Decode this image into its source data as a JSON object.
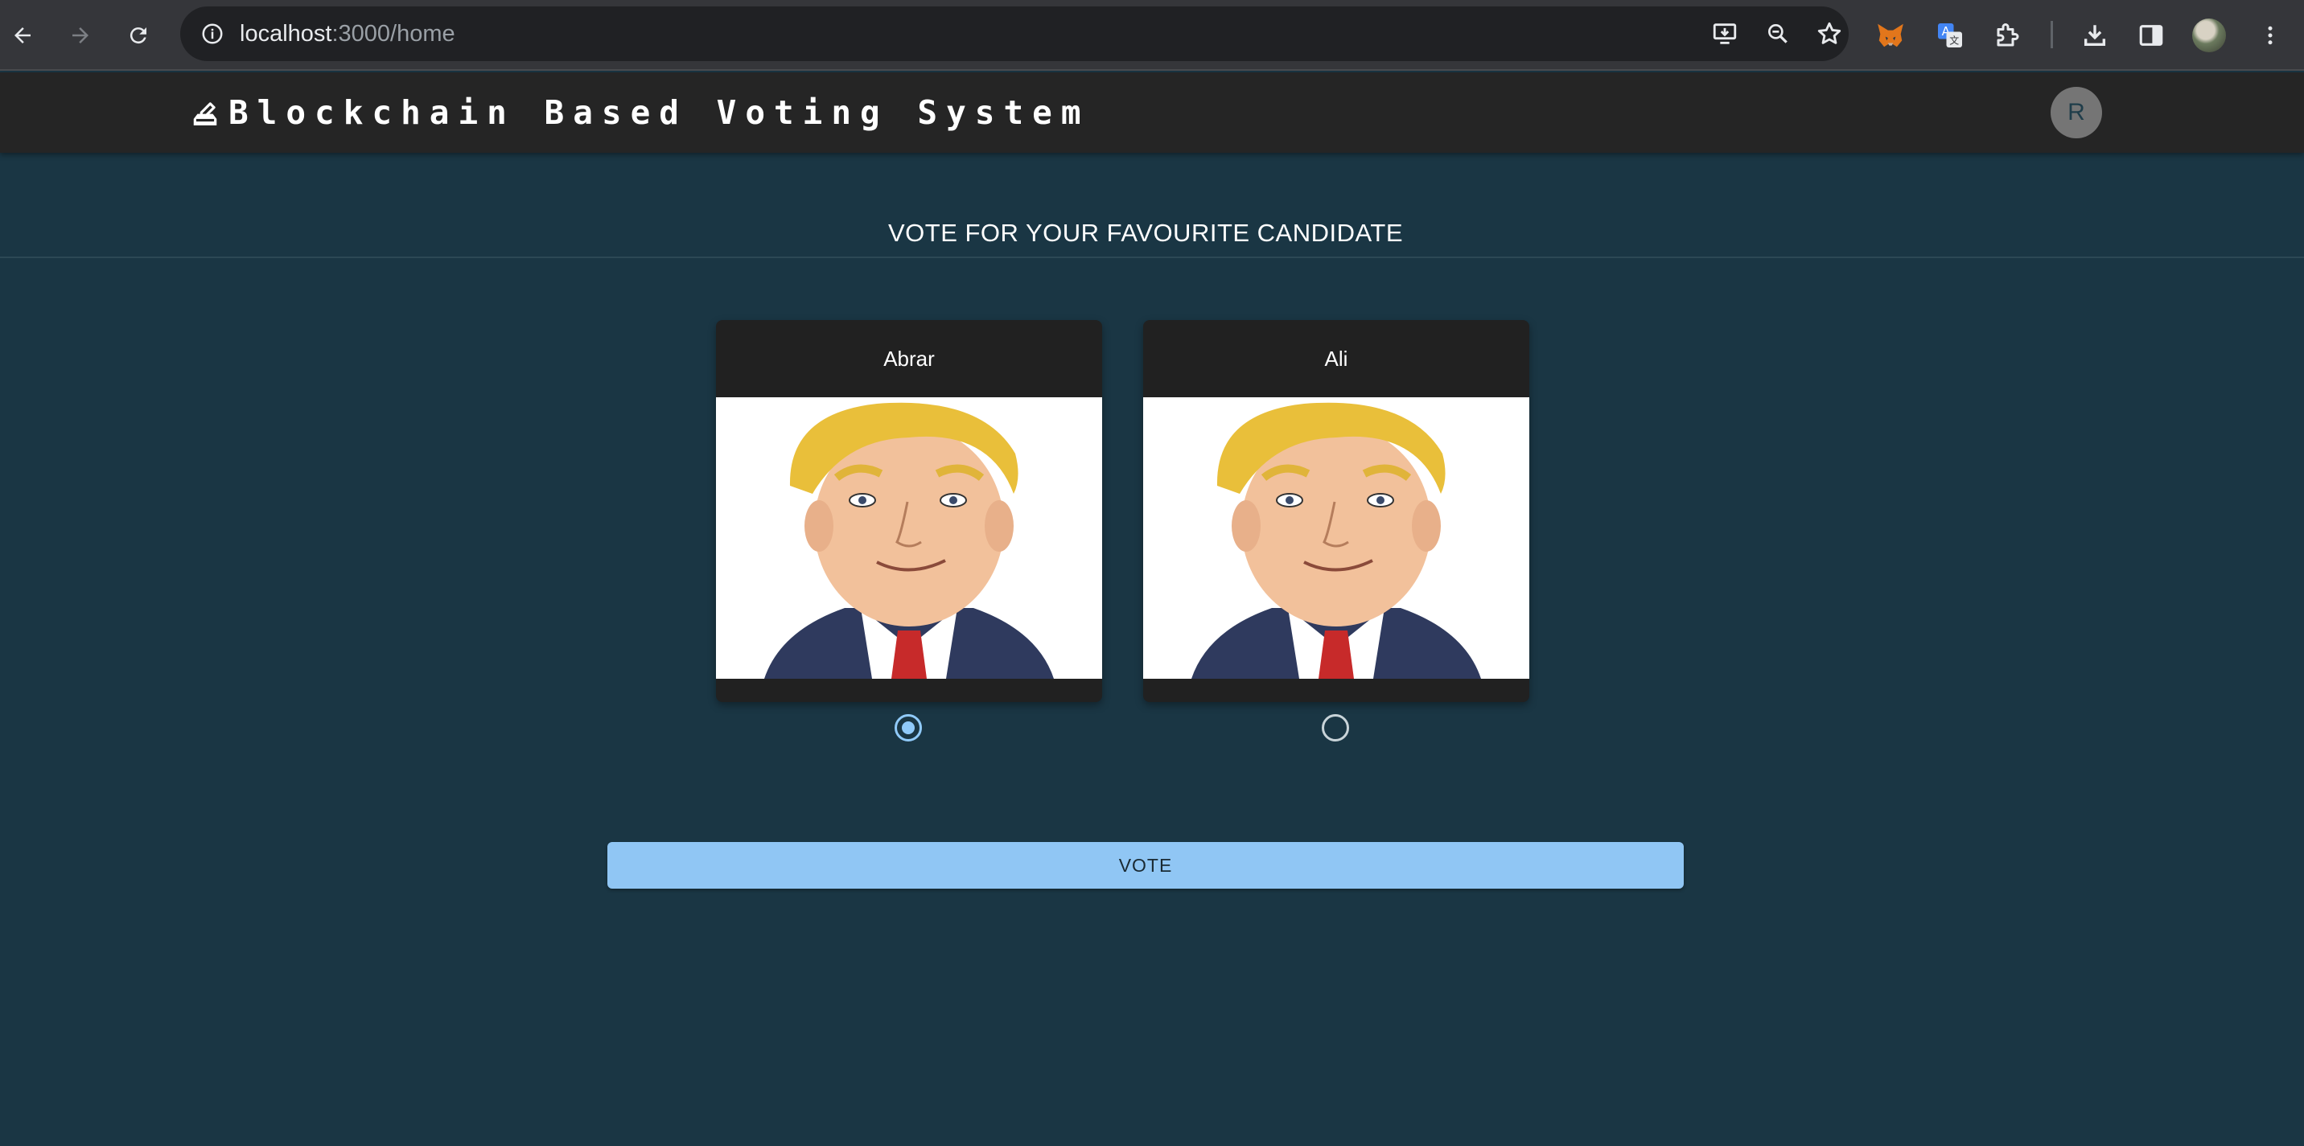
{
  "browser": {
    "url_host": "localhost",
    "url_rest": ":3000/home",
    "icons": [
      "back-arrow-icon",
      "forward-arrow-icon",
      "reload-icon",
      "site-info-icon",
      "install-app-icon",
      "zoom-icon",
      "bookmark-star-icon",
      "metamask-fox-icon",
      "translate-icon",
      "extensions-puzzle-icon",
      "download-icon",
      "side-panel-icon",
      "profile-avatar-icon",
      "kebab-menu-icon"
    ]
  },
  "header": {
    "title": "Blockchain Based Voting System",
    "icon": "ballot-box-icon",
    "avatar_initial": "R"
  },
  "main": {
    "heading": "VOTE FOR YOUR FAVOURITE CANDIDATE",
    "candidates": [
      {
        "name": "Abrar",
        "selected": true
      },
      {
        "name": "Ali",
        "selected": false
      }
    ],
    "vote_button_label": "VOTE"
  },
  "colors": {
    "page_background": "#1a3644",
    "header_background": "#252525",
    "card_background": "#212121",
    "accent": "#90caf9",
    "vote_button": "#90c6f4"
  }
}
